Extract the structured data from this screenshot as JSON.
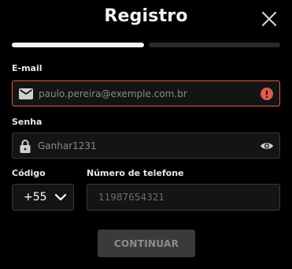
{
  "header": {
    "title": "Registro",
    "close_icon": "close-icon"
  },
  "progress": {
    "steps_total": 2,
    "current_step": 1
  },
  "email": {
    "label": "E-mail",
    "value": "paulo.pereira@exemple.com.br",
    "leading_icon": "mail-icon",
    "trailing_icon": "error-icon",
    "state": "error"
  },
  "password": {
    "label": "Senha",
    "value": "Ganhar1231",
    "leading_icon": "lock-icon",
    "trailing_icon": "eye-icon"
  },
  "country_code": {
    "label": "Código",
    "value": "+55",
    "icon": "chevron-down-icon"
  },
  "phone": {
    "label": "Número de telefone",
    "placeholder": "11987654321"
  },
  "actions": {
    "continue_label": "CONTINUAR"
  },
  "colors": {
    "background": "#000000",
    "error": "#e05a4d",
    "button_bg": "#3a3a3a",
    "field_bg": "#141414"
  }
}
